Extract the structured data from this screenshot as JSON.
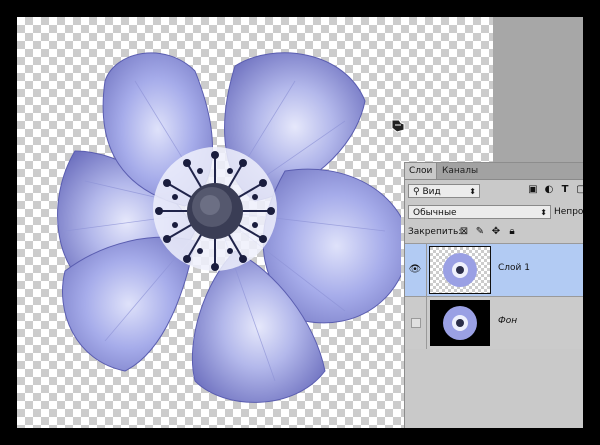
{
  "layers_panel": {
    "tabs": [
      {
        "label": "Слои"
      },
      {
        "label": "Каналы"
      }
    ],
    "filter": {
      "value": "Вид"
    },
    "filter_icons": [
      "image-filter-icon",
      "adjustment-filter-icon",
      "type-filter-icon",
      "shape-filter-icon"
    ],
    "blend_mode": {
      "value": "Обычные"
    },
    "opacity_label": "Непрозр",
    "lock": {
      "label": "Закрепить:",
      "icons": [
        "lock-transparent-icon",
        "lock-brush-icon",
        "lock-move-icon",
        "lock-all-icon"
      ]
    },
    "layers": [
      {
        "name": "Слой 1",
        "visible": true,
        "selected": true,
        "background": "transparent"
      },
      {
        "name": "Фон",
        "visible": false,
        "selected": false,
        "background": "#000000"
      }
    ]
  },
  "colors": {
    "canvas_checker": "#cccccc",
    "workspace": "#a7a7a7",
    "selected_layer": "#b2cbf3",
    "panel": "#c9c9c9"
  }
}
